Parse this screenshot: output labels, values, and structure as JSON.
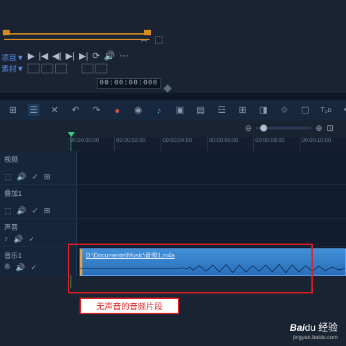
{
  "preview": {
    "label_project": "项目▼",
    "label_clip": "素材▼",
    "right_icons": [
      "↔",
      "⬚"
    ]
  },
  "playback": {
    "controls": [
      "▶",
      "|◀",
      "◀|",
      "▶|",
      "▶|",
      "⟳",
      "🔊",
      "⋯"
    ]
  },
  "timecode": {
    "value": "00:00:00:000",
    "spinner": "◆"
  },
  "toolbar": {
    "items": [
      {
        "name": "storyboard",
        "glyph": "⊞"
      },
      {
        "name": "timeline",
        "glyph": "☰",
        "selected": true
      },
      {
        "name": "tools",
        "glyph": "✕"
      },
      {
        "name": "undo",
        "glyph": "↶"
      },
      {
        "name": "redo",
        "glyph": "↷"
      },
      {
        "name": "record",
        "glyph": "●"
      },
      {
        "name": "mixer",
        "glyph": "◉"
      },
      {
        "name": "auto-music",
        "glyph": "♪"
      },
      {
        "name": "chapter",
        "glyph": "▣"
      },
      {
        "name": "subtitle",
        "glyph": "▤"
      },
      {
        "name": "tracks",
        "glyph": "☲"
      },
      {
        "name": "grid",
        "glyph": "⊞"
      },
      {
        "name": "marker",
        "glyph": "◨"
      },
      {
        "name": "fit",
        "glyph": "⟐"
      },
      {
        "name": "crop",
        "glyph": "▢"
      },
      {
        "name": "3d",
        "glyph": "T₃ᴅ"
      },
      {
        "name": "ripple",
        "glyph": "⟲"
      }
    ]
  },
  "zoom": {
    "out": "⊖",
    "in": "⊕",
    "fit": "⊡"
  },
  "ruler": {
    "ticks": [
      "00:00:00:00",
      "00:00:02:00",
      "00:00:04:00",
      "00:00:06:00",
      "00:00:08:00",
      "00:00:10:00"
    ]
  },
  "tracks": [
    {
      "label": "视频",
      "icons": [
        "⬚",
        "🔊",
        "✓",
        "⊞"
      ]
    },
    {
      "label": "叠加1",
      "icons": [
        "⬚",
        "🔊",
        "✓",
        "⊞"
      ]
    },
    {
      "label": "声音",
      "icons": [
        "♪",
        "🔊",
        "✓"
      ]
    },
    {
      "label": "音乐1",
      "icons": [
        "ꔮ",
        "🔊",
        "✓"
      ],
      "clip": {
        "path": "D:\\Documents\\Music\\音频1.m4a"
      }
    }
  ],
  "annotation": "无声音的音频片段",
  "watermark": {
    "main": "Baidu 经验",
    "sub": "jingyan.baidu.com"
  }
}
